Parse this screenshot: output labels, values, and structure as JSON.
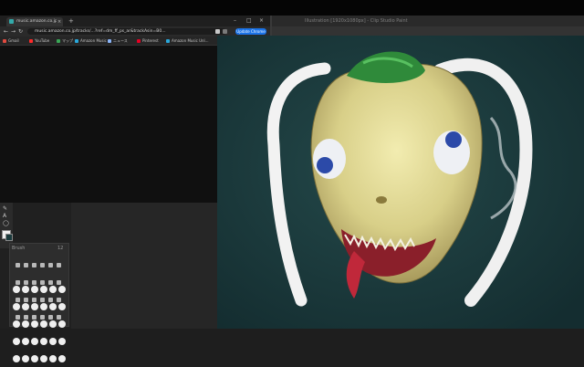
{
  "browser": {
    "tab": {
      "title": "music.amazon.co.jp/Tracks...",
      "close": "×"
    },
    "new_tab": "+",
    "window_controls": {
      "minimize": "–",
      "maximize": "□",
      "close": "×"
    },
    "nav": {
      "back": "←",
      "forward": "→",
      "reload": "↻"
    },
    "address": "music.amazon.co.jp/tracks/...?ref=dm_ff_ps_ar&trackAsin=B0...",
    "update_button": "Update Chrome",
    "bookmarks": [
      {
        "label": "Gmail",
        "color": "#e04a3f"
      },
      {
        "label": "YouTube",
        "color": "#ff2a2a"
      },
      {
        "label": "マップ",
        "color": "#3aa757"
      },
      {
        "label": "Amazon Music",
        "color": "#2aa7d9"
      },
      {
        "label": "ニュース",
        "color": "#8ab4f8"
      },
      {
        "label": "Pinterest",
        "color": "#e60023"
      },
      {
        "label": "Amazon Music Unl...",
        "color": "#2aa7d9"
      }
    ]
  },
  "paint_app": {
    "title": "Illustration [1920x1080px] - Clip Studio Paint",
    "tools": {
      "pen": "✎",
      "text": "A",
      "shape": "◯"
    },
    "brush_palette": {
      "tab_label": "Brush",
      "size_value": "12"
    }
  },
  "colors": {
    "canvas_bg": "#1a3a3c",
    "creature_skin": "#e8dfa0",
    "hat_green": "#2f8a3a",
    "mouth_red": "#8a1f2a",
    "whiskers": "#f2f2f2"
  },
  "icons": [
    "back-icon",
    "forward-icon",
    "reload-icon",
    "pen-icon",
    "text-icon",
    "shape-icon",
    "color-swatch-icon"
  ]
}
